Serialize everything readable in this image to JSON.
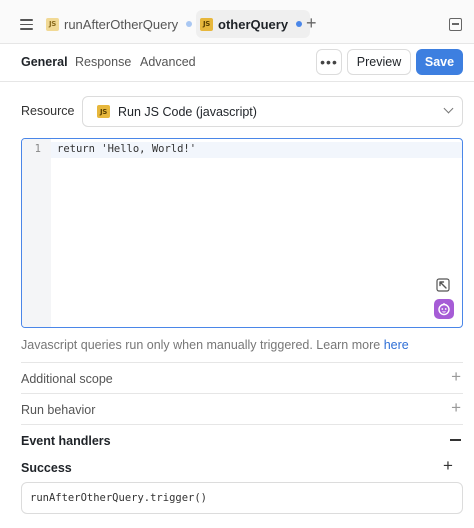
{
  "tabs": [
    {
      "label": "runAfterOtherQuery",
      "badge": "JS"
    },
    {
      "label": "otherQuery",
      "badge": "JS"
    }
  ],
  "subtabs": {
    "general": "General",
    "response": "Response",
    "advanced": "Advanced"
  },
  "toolbar": {
    "more": "•••",
    "preview": "Preview",
    "save": "Save"
  },
  "resource": {
    "label": "Resource",
    "badge": "JS",
    "value": "Run JS Code (javascript)"
  },
  "editor": {
    "line_number": "1",
    "code": "return 'Hello, World!'"
  },
  "help": {
    "text": "Javascript queries run only when manually triggered. Learn more ",
    "link": "here"
  },
  "sections": {
    "additional_scope": "Additional scope",
    "run_behavior": "Run behavior",
    "event_handlers": "Event handlers"
  },
  "success": {
    "label": "Success",
    "handler": "runAfterOtherQuery.trigger()"
  },
  "colors": {
    "accent": "#3d7fe0",
    "js_badge": "#e7b73c",
    "assist": "#a65cd6"
  }
}
